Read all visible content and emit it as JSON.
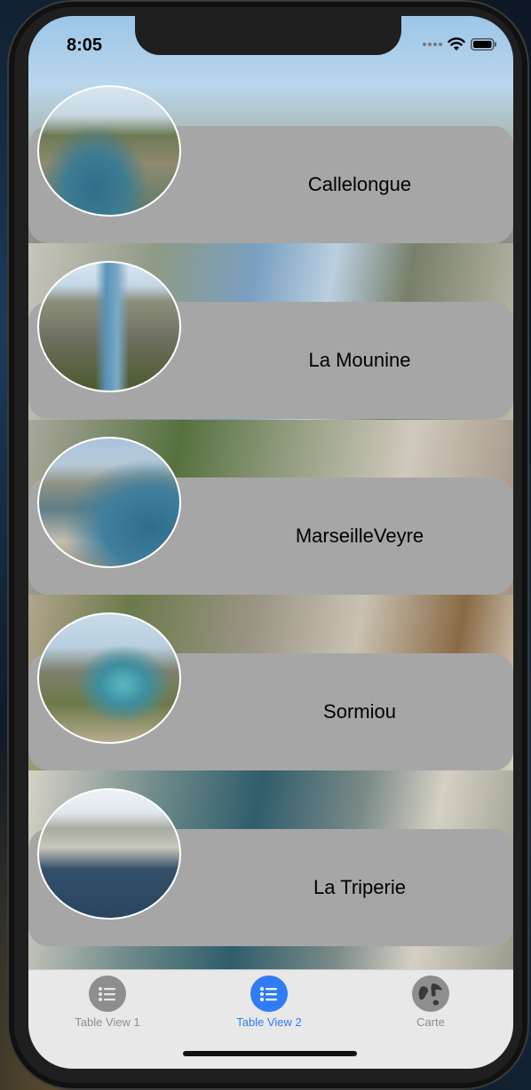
{
  "status_bar": {
    "time": "8:05",
    "wifi_icon": "wifi-icon",
    "battery_icon": "battery-icon"
  },
  "list": {
    "items": [
      {
        "label": "Callelongue",
        "thumbnail": "photo-callelongue"
      },
      {
        "label": "La Mounine",
        "thumbnail": "photo-la-mounine"
      },
      {
        "label": "MarseilleVeyre",
        "thumbnail": "photo-marseilleveyre"
      },
      {
        "label": "Sormiou",
        "thumbnail": "photo-sormiou"
      },
      {
        "label": "La Triperie",
        "thumbnail": "photo-la-triperie"
      }
    ]
  },
  "tab_bar": {
    "tabs": [
      {
        "label": "Table View 1",
        "icon": "list-icon",
        "selected": false
      },
      {
        "label": "Table View 2",
        "icon": "list-icon",
        "selected": true
      },
      {
        "label": "Carte",
        "icon": "globe-icon",
        "selected": false
      }
    ]
  },
  "colors": {
    "accent": "#2f7cf6",
    "inactive": "#8e8e8e",
    "cell_background": "#a6a6a6"
  }
}
